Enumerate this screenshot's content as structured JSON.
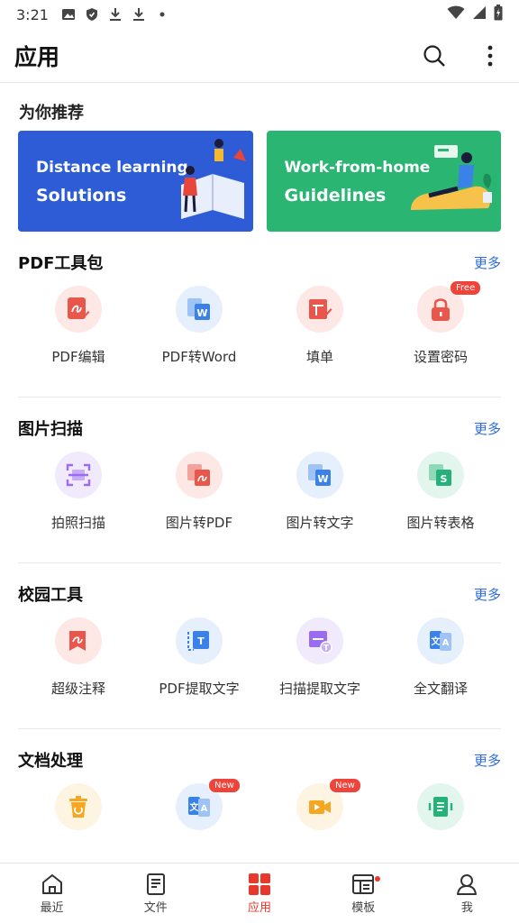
{
  "status": {
    "time": "3:21"
  },
  "appbar": {
    "title": "应用"
  },
  "recommend": {
    "title": "为你推荐",
    "banners": [
      {
        "line1": "Distance learning",
        "line2": "Solutions"
      },
      {
        "line1": "Work-from-home",
        "line2": "Guidelines"
      }
    ]
  },
  "sections": [
    {
      "title": "PDF工具包",
      "more": "更多",
      "tools": [
        {
          "label": "PDF编辑",
          "icon": "pdf-edit-icon",
          "color": "#e9564b",
          "bg": "#fde8e6"
        },
        {
          "label": "PDF转Word",
          "icon": "pdf-to-word-icon",
          "color": "#3b82e8",
          "bg": "#e6f0fd"
        },
        {
          "label": "填单",
          "icon": "fill-form-icon",
          "color": "#e9564b",
          "bg": "#fde8e6"
        },
        {
          "label": "设置密码",
          "icon": "lock-icon",
          "color": "#e9564b",
          "bg": "#fde8e6",
          "badge": "Free"
        }
      ]
    },
    {
      "title": "图片扫描",
      "more": "更多",
      "tools": [
        {
          "label": "拍照扫描",
          "icon": "scan-icon",
          "color": "#9a6cf0",
          "bg": "#f1eafd"
        },
        {
          "label": "图片转PDF",
          "icon": "image-to-pdf-icon",
          "color": "#e9564b",
          "bg": "#fde8e6"
        },
        {
          "label": "图片转文字",
          "icon": "image-to-text-icon",
          "color": "#3b82e8",
          "bg": "#e6f0fd"
        },
        {
          "label": "图片转表格",
          "icon": "image-to-sheet-icon",
          "color": "#26b07a",
          "bg": "#e3f6ee"
        }
      ]
    },
    {
      "title": "校园工具",
      "more": "更多",
      "tools": [
        {
          "label": "超级注释",
          "icon": "annotate-icon",
          "color": "#e9564b",
          "bg": "#fde8e6"
        },
        {
          "label": "PDF提取文字",
          "icon": "pdf-extract-text-icon",
          "color": "#3b82e8",
          "bg": "#e6f0fd"
        },
        {
          "label": "扫描提取文字",
          "icon": "scan-extract-text-icon",
          "color": "#9a6cf0",
          "bg": "#f1eafd"
        },
        {
          "label": "全文翻译",
          "icon": "translate-icon",
          "color": "#3b82e8",
          "bg": "#e6f0fd"
        }
      ]
    },
    {
      "title": "文档处理",
      "more": "更多",
      "tools": [
        {
          "label": "",
          "icon": "doc-clean-icon",
          "color": "#f5a623",
          "bg": "#fef4e2"
        },
        {
          "label": "",
          "icon": "doc-translate-icon",
          "color": "#3b82e8",
          "bg": "#e6f0fd",
          "badge": "New"
        },
        {
          "label": "",
          "icon": "doc-video-icon",
          "color": "#f5a623",
          "bg": "#fef4e2",
          "badge": "New"
        },
        {
          "label": "",
          "icon": "doc-sheet-icon",
          "color": "#26b07a",
          "bg": "#e3f6ee"
        }
      ]
    }
  ],
  "tabs": [
    {
      "label": "最近",
      "icon": "home-icon"
    },
    {
      "label": "文件",
      "icon": "file-icon"
    },
    {
      "label": "应用",
      "icon": "apps-icon",
      "active": true
    },
    {
      "label": "模板",
      "icon": "template-icon",
      "dot": true
    },
    {
      "label": "我",
      "icon": "person-icon"
    }
  ],
  "colors": {
    "accent": "#e8382c",
    "link": "#2d6be0"
  }
}
